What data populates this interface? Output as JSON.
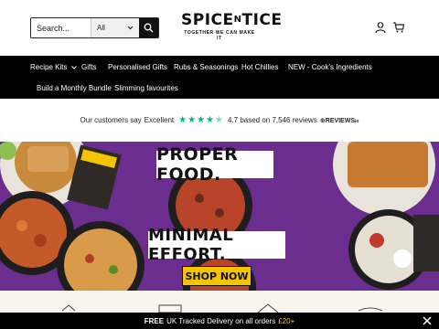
{
  "search": {
    "placeholder": "Search...",
    "category": "All"
  },
  "logo": {
    "name_a": "SPICE",
    "name_small": "N",
    "name_b": "TICE",
    "tagline": "TOGETHER WE CAN MAKE IT"
  },
  "nav": {
    "items": [
      {
        "label": "Recipe Kits"
      },
      {
        "label": "Gifts"
      },
      {
        "label": "Personalised Gifts"
      },
      {
        "label": "Rubs & Seasonings"
      },
      {
        "label": "Hot Chillies"
      },
      {
        "label": "NEW - Cook's Ingredients"
      },
      {
        "label": "Build a Monthly Bundle"
      },
      {
        "label": "Slimming favourites"
      }
    ]
  },
  "reviews": {
    "prefix": "Our customers say",
    "rating_word": "Excellent",
    "rating_value": 4.7,
    "summary": "4.7 based on 7,546 reviews",
    "provider": "REVIEWS",
    "provider_suffix": "io",
    "star_color": "#00b67a"
  },
  "hero": {
    "headline_1": "PROPER FOOD.",
    "headline_2": "MINIMAL EFFORT.",
    "cta": "SHOP NOW",
    "background_color": "#6b2d8e",
    "cta_color": "#f5c400"
  },
  "announcement": {
    "bold": "FREE",
    "text": "UK Tracked Delivery on all orders",
    "highlight": "£20+",
    "highlight_color": "#f5c400"
  }
}
